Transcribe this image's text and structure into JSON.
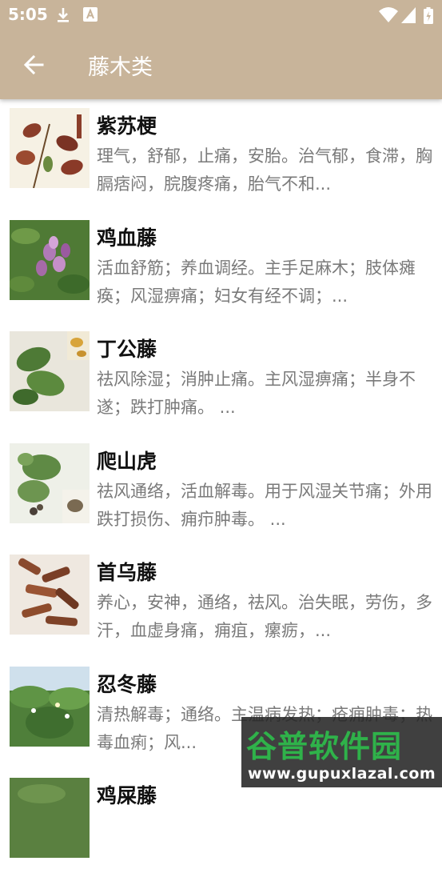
{
  "status_bar": {
    "time": "5:05",
    "left_icons": [
      "download-icon",
      "a-notification-icon"
    ],
    "right_icons": [
      "wifi-icon",
      "signal-icon",
      "battery-icon"
    ]
  },
  "toolbar": {
    "back_icon": "arrow-left-icon",
    "title": "藤木类",
    "background": "#c8b49a"
  },
  "items": [
    {
      "name": "紫苏梗",
      "desc": "理气，舒郁，止痛，安胎。治气郁，食滞，胸膈痞闷，脘腹疼痛，胎气不和..."
    },
    {
      "name": "鸡血藤",
      "desc": "活血舒筋；养血调经。主手足麻木；肢体瘫痪；风湿痹痛；妇女有经不调；..."
    },
    {
      "name": "丁公藤",
      "desc": "祛风除湿；消肿止痛。主风湿痹痛；半身不遂；跌打肿痛。 ..."
    },
    {
      "name": "爬山虎",
      "desc": "祛风通络，活血解毒。用于风湿关节痛；外用跌打损伤、痈疖肿毒。 ..."
    },
    {
      "name": "首乌藤",
      "desc": "养心，安神，通络，祛风。治失眠，劳伤，多汗，血虚身痛，痈疽，瘰疬，..."
    },
    {
      "name": "忍冬藤",
      "desc": "清热解毒；通络。主温病发热；疮痈肿毒；热毒血痢；风..."
    },
    {
      "name": "鸡屎藤",
      "desc": ""
    }
  ],
  "watermark": {
    "brand": "谷普软件园",
    "url": "www.gupuxlazal.com"
  }
}
